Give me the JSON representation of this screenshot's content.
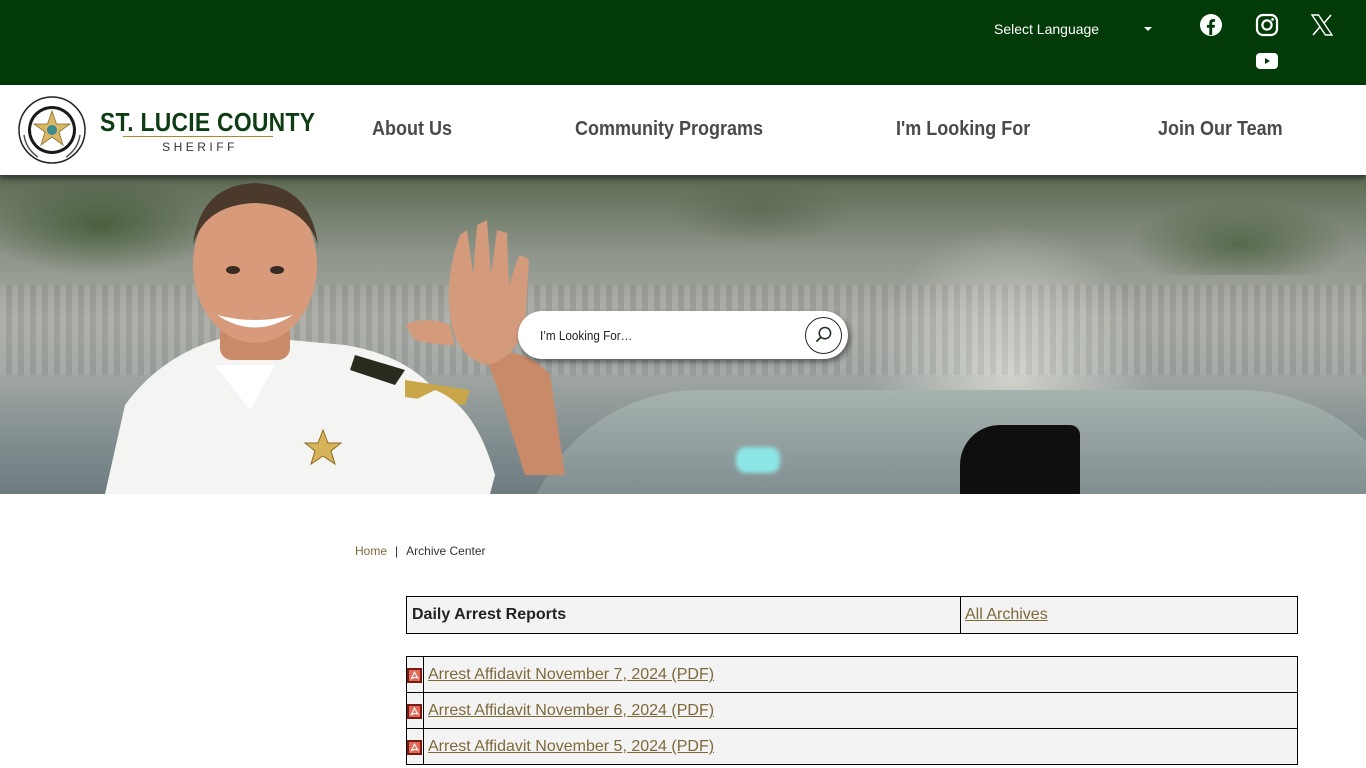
{
  "topbar": {
    "language_select": {
      "selected": "Select Language"
    },
    "social": [
      {
        "name": "facebook",
        "icon": "facebook-icon"
      },
      {
        "name": "instagram",
        "icon": "instagram-icon"
      },
      {
        "name": "x",
        "icon": "x-icon"
      },
      {
        "name": "youtube",
        "icon": "youtube-icon"
      }
    ]
  },
  "header": {
    "brand_title": "ST. LUCIE COUNTY",
    "brand_subtitle": "SHERIFF",
    "nav": [
      {
        "label": "About Us"
      },
      {
        "label": "Community Programs"
      },
      {
        "label": "I'm Looking For"
      },
      {
        "label": "Join Our Team"
      }
    ]
  },
  "hero": {
    "search": {
      "placeholder": "I’m Looking For…",
      "value": ""
    }
  },
  "breadcrumb": {
    "home": "Home",
    "separator": "|",
    "current": "Archive Center"
  },
  "archive": {
    "title": "Daily Arrest Reports",
    "all_archives_label": "All Archives",
    "items": [
      {
        "label": "Arrest Affidavit November 7, 2024 (PDF)",
        "icon": "pdf-icon"
      },
      {
        "label": "Arrest Affidavit November 6, 2024 (PDF)",
        "icon": "pdf-icon"
      },
      {
        "label": "Arrest Affidavit November 5, 2024 (PDF)",
        "icon": "pdf-icon"
      }
    ]
  },
  "colors": {
    "topbar_bg": "#023a08",
    "brand_green": "#0e3d14",
    "link_gold": "#7d6a3a",
    "nav_text": "#4a4a4a"
  }
}
